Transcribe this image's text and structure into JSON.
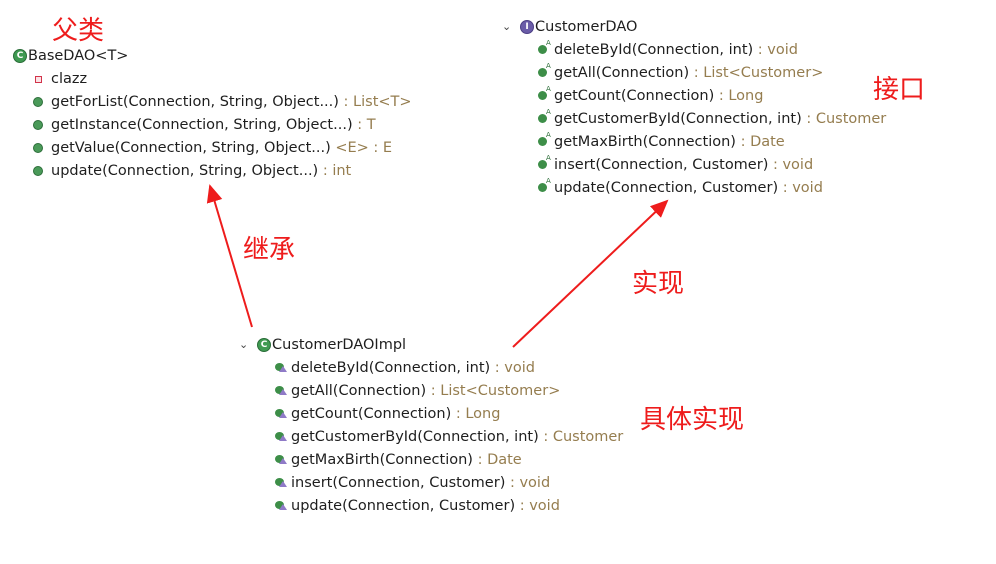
{
  "annotations": {
    "parent": "父类",
    "inherit": "继承",
    "implement": "实现",
    "interface": "接口",
    "concrete": "具体实现"
  },
  "base": {
    "name": "BaseDAO<T>",
    "field": "clazz",
    "methods": [
      {
        "sig": "getForList(Connection, String, Object...)",
        "type": " : List<T>"
      },
      {
        "sig": "getInstance(Connection, String, Object...)",
        "type": " : T"
      },
      {
        "sig": "getValue(Connection, String, Object...)",
        "type": " <E> : E"
      },
      {
        "sig": "update(Connection, String, Object...)",
        "type": " : int"
      }
    ]
  },
  "iface": {
    "name": "CustomerDAO",
    "methods": [
      {
        "sig": "deleteById(Connection, int)",
        "type": " : void"
      },
      {
        "sig": "getAll(Connection)",
        "type": " : List<Customer>"
      },
      {
        "sig": "getCount(Connection)",
        "type": " : Long"
      },
      {
        "sig": "getCustomerById(Connection, int)",
        "type": " : Customer"
      },
      {
        "sig": "getMaxBirth(Connection)",
        "type": " : Date"
      },
      {
        "sig": "insert(Connection, Customer)",
        "type": " : void"
      },
      {
        "sig": "update(Connection, Customer)",
        "type": " : void"
      }
    ]
  },
  "impl": {
    "name": "CustomerDAOImpl",
    "methods": [
      {
        "sig": "deleteById(Connection, int)",
        "type": " : void"
      },
      {
        "sig": "getAll(Connection)",
        "type": " : List<Customer>"
      },
      {
        "sig": "getCount(Connection)",
        "type": " : Long"
      },
      {
        "sig": "getCustomerById(Connection, int)",
        "type": " : Customer"
      },
      {
        "sig": "getMaxBirth(Connection)",
        "type": " : Date"
      },
      {
        "sig": "insert(Connection, Customer)",
        "type": " : void"
      },
      {
        "sig": "update(Connection, Customer)",
        "type": " : void"
      }
    ]
  },
  "colors": {
    "annotation": "#ee1c1c",
    "type": "#957d4f"
  }
}
